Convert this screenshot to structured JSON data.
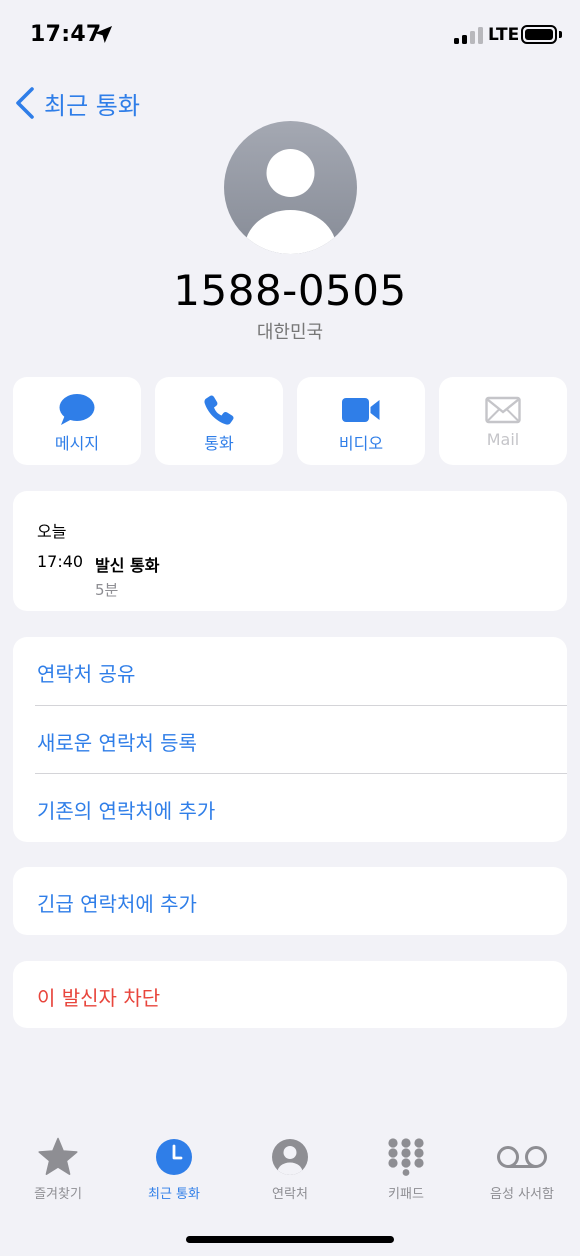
{
  "status_bar": {
    "time": "17:47",
    "network": "LTE",
    "signal_bars_active": 2,
    "signal_bars_total": 4,
    "battery_level": 1.0
  },
  "nav": {
    "back_label": "최근 통화"
  },
  "contact": {
    "phone_number": "1588-0505",
    "country": "대한민국",
    "avatar_icon": "person-silhouette-icon"
  },
  "actions": [
    {
      "label": "메시지",
      "icon": "message-bubble-icon",
      "enabled": true
    },
    {
      "label": "통화",
      "icon": "phone-icon",
      "enabled": true
    },
    {
      "label": "비디오",
      "icon": "video-camera-icon",
      "enabled": true
    },
    {
      "label": "Mail",
      "icon": "mail-envelope-icon",
      "enabled": false
    }
  ],
  "call_history": {
    "date_label": "오늘",
    "entries": [
      {
        "time": "17:40",
        "type": "발신 통화",
        "duration": "5분"
      }
    ]
  },
  "contact_options": {
    "items": [
      {
        "label": "연락처 공유"
      },
      {
        "label": "새로운 연락처 등록"
      },
      {
        "label": "기존의 연락처에 추가"
      }
    ]
  },
  "emergency": {
    "label": "긴급 연락처에 추가"
  },
  "block": {
    "label": "이 발신자 차단"
  },
  "tab_bar": {
    "tabs": [
      {
        "label": "즐겨찾기",
        "icon": "star-icon",
        "active": false
      },
      {
        "label": "최근 통화",
        "icon": "clock-icon",
        "active": true
      },
      {
        "label": "연락처",
        "icon": "person-circle-icon",
        "active": false
      },
      {
        "label": "키패드",
        "icon": "keypad-icon",
        "active": false
      },
      {
        "label": "음성 사서함",
        "icon": "voicemail-icon",
        "active": false
      }
    ]
  },
  "colors": {
    "accent": "#2f7ee8",
    "destructive": "#e8453c",
    "background": "#f2f2f7",
    "card": "#ffffff",
    "secondary_text": "#8e8e93",
    "disabled": "#c5c5c9"
  }
}
